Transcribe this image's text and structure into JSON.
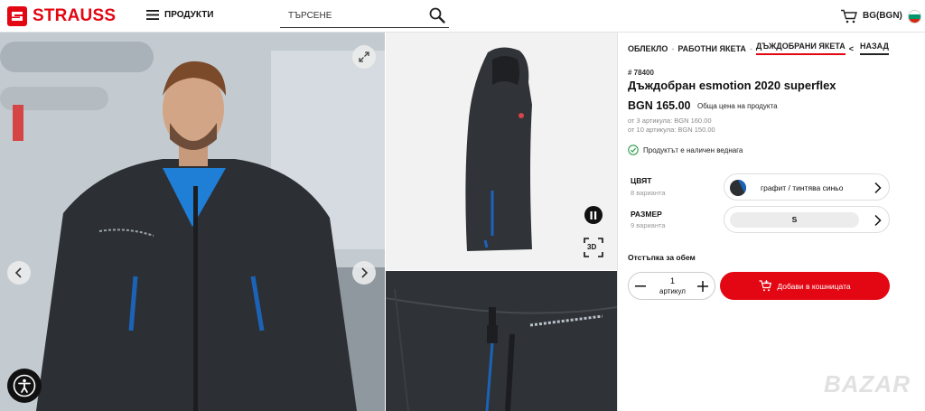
{
  "header": {
    "brand": "STRAUSS",
    "menu_label": "ПРОДУКТИ",
    "search_placeholder": "ТЪРСЕНЕ",
    "language": "BG(BGN)"
  },
  "breadcrumbs": {
    "items": [
      "ОБЛЕКЛО",
      "РАБОТНИ ЯКЕТА",
      "ДЪЖДОБРАНИ ЯКЕТА"
    ],
    "separator": "-",
    "back_arrow": "<",
    "back_label": "НАЗАД"
  },
  "product": {
    "sku": "# 78400",
    "title": "Дъждобран esmotion 2020 superflex",
    "price": "BGN 165.00",
    "price_note": "Обща цена на продукта",
    "tier_prices": [
      "от 3 артикула: BGN 160.00",
      "от 10 артикула: BGN 150.00"
    ],
    "stock_status": "Продуктът е наличен веднага"
  },
  "options": {
    "color": {
      "label": "ЦВЯТ",
      "variants": "8 варианта",
      "selected": "графит / тинтява синьо"
    },
    "size": {
      "label": "РАЗМЕР",
      "variants": "9 варианта",
      "selected": "S"
    }
  },
  "purchase": {
    "volume_discount": "Отстъпка за обем",
    "quantity": "1",
    "quantity_unit": "артикул",
    "add_to_cart": "Добави в кошницата"
  },
  "gallery": {
    "badge_3d": "3D"
  },
  "watermark": "BAZAR",
  "colors": {
    "accent": "#e30613",
    "jacket_dark": "#2d3033",
    "jacket_blue": "#1c63b8",
    "text": "#111111"
  },
  "icons": [
    "menu-icon",
    "search-icon",
    "cart-icon",
    "expand-icon",
    "chevron-left-icon",
    "chevron-right-icon",
    "accessibility-icon",
    "pause-icon",
    "3d-view-icon",
    "check-circle-icon",
    "minus-icon",
    "plus-icon",
    "cart-add-icon"
  ]
}
